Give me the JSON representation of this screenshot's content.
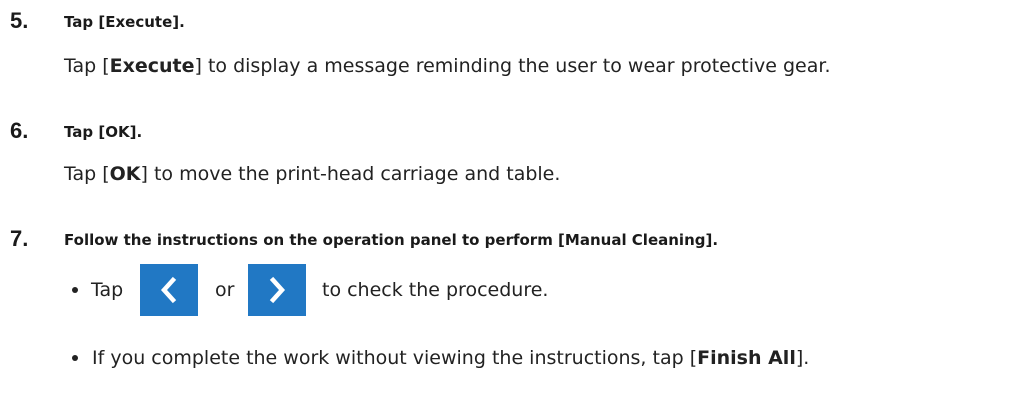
{
  "steps": [
    {
      "number": "5.",
      "title": "Tap [Execute].",
      "body_pre": "Tap [",
      "body_bold": "Execute",
      "body_post": "] to display a message reminding the user to wear protective gear."
    },
    {
      "number": "6.",
      "title": "Tap [OK].",
      "body_pre": "Tap [",
      "body_bold": "OK",
      "body_post": "] to move the print-head carriage and table."
    },
    {
      "number": "7.",
      "title": "Follow the instructions on the operation panel to perform [Manual Cleaning].",
      "bullet1": {
        "tap": "Tap",
        "or": "or",
        "tail": "to check the procedure.",
        "prev_icon": "chevron-left-icon",
        "next_icon": "chevron-right-icon"
      },
      "bullet2": {
        "pre": "If you complete the work without viewing the instructions, tap [",
        "bold": "Finish All",
        "post": "]."
      }
    }
  ],
  "colors": {
    "nav_button": "#2178c4",
    "text": "#222222"
  }
}
